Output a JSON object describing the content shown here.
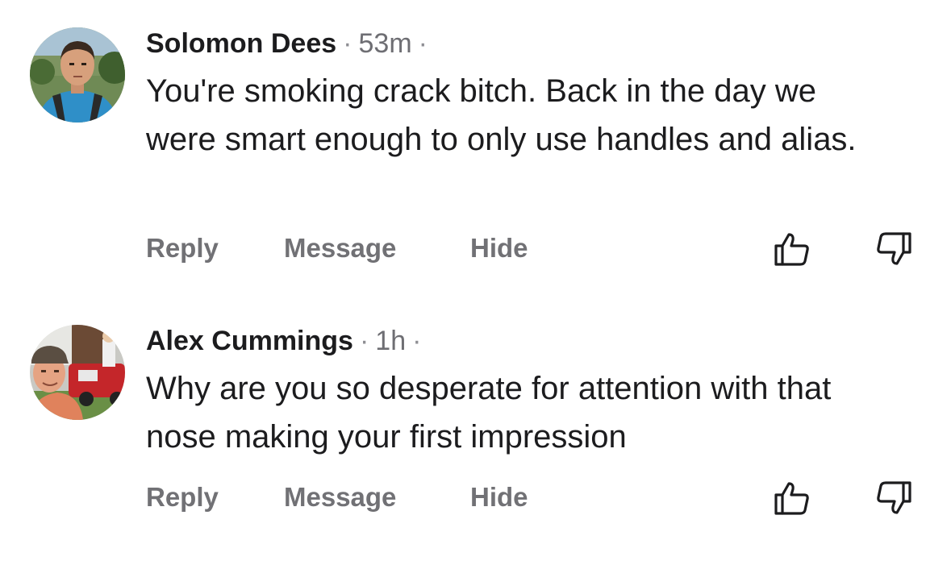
{
  "comments": [
    {
      "author": "Solomon Dees",
      "separator": "·",
      "time": "53m",
      "text": "You're smoking crack bitch.  Back in the day we were smart enough to only use handles and alias.",
      "actions": {
        "reply": "Reply",
        "message": "Message",
        "hide": "Hide"
      },
      "icons": {
        "avatar": "avatar-solomon-dees",
        "like": "thumbs-up-icon",
        "dislike": "thumbs-down-icon"
      }
    },
    {
      "author": "Alex Cummings",
      "separator": "·",
      "time": "1h",
      "text": "Why are you so desperate for attention with that nose making your first impression",
      "actions": {
        "reply": "Reply",
        "message": "Message",
        "hide": "Hide"
      },
      "icons": {
        "avatar": "avatar-alex-cummings",
        "like": "thumbs-up-icon",
        "dislike": "thumbs-down-icon"
      }
    }
  ],
  "colors": {
    "text_primary": "#1c1c1e",
    "text_secondary": "#6e6e73",
    "action_text": "#717175",
    "icon_stroke": "#1c1c1e"
  }
}
